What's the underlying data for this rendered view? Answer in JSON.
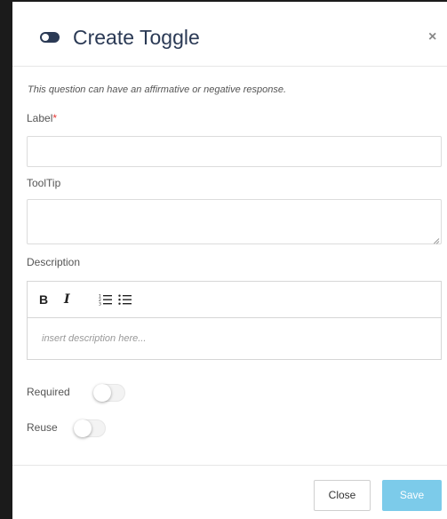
{
  "header": {
    "title": "Create Toggle",
    "icon": "toggle-icon",
    "close_glyph": "×"
  },
  "hint": "This question can have an affirmative or negative response.",
  "fields": {
    "label": {
      "label": "Label",
      "required_marker": "*",
      "value": ""
    },
    "tooltip": {
      "label": "ToolTip",
      "value": ""
    },
    "description": {
      "label": "Description",
      "toolbar": {
        "bold": "B",
        "italic": "I",
        "ordered_list_icon": "ordered-list-icon",
        "bullet_list_icon": "bullet-list-icon"
      },
      "placeholder": "insert description here..."
    }
  },
  "switches": {
    "required": {
      "label": "Required",
      "on": false
    },
    "reuse": {
      "label": "Reuse",
      "on": false
    }
  },
  "footer": {
    "close_label": "Close",
    "save_label": "Save"
  },
  "colors": {
    "title": "#2b3a55",
    "required_marker": "#e53935",
    "save_button": "#7ccbea"
  }
}
